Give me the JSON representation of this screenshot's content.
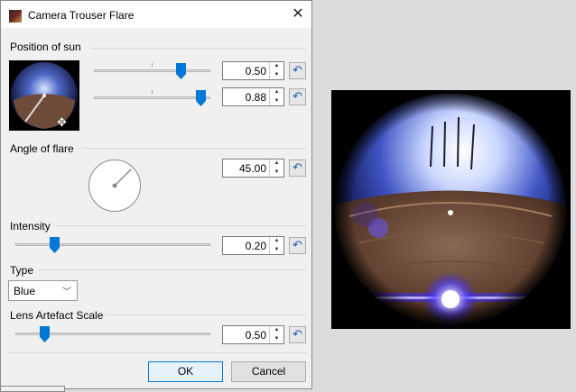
{
  "window": {
    "title": "Camera Trouser Flare"
  },
  "sections": {
    "position_of_sun": "Position of sun",
    "angle_of_flare": "Angle of flare",
    "intensity": "Intensity",
    "type": "Type",
    "lens_artefact_scale": "Lens Artefact Scale"
  },
  "controls": {
    "sun_x": {
      "value": "0.50",
      "level": 0.5
    },
    "sun_y": {
      "value": "0.88",
      "level": 0.88
    },
    "angle": {
      "value": "45.00",
      "degrees": 45
    },
    "intensity": {
      "value": "0.20",
      "level": 0.2
    },
    "type": {
      "selected": "Blue"
    },
    "lens_artefact_scale": {
      "value": "0.50",
      "level": 0.15
    }
  },
  "buttons": {
    "ok": "OK",
    "cancel": "Cancel"
  },
  "icons": {
    "close": "close-icon",
    "reset": "reset-icon",
    "spin_up": "chevron-up-icon",
    "spin_down": "chevron-down-icon",
    "dropdown": "chevron-down-icon",
    "move_cursor": "move-cursor-icon"
  },
  "colors": {
    "accent": "#0078d7",
    "dialog_bg": "#f0f0f0",
    "desktop_bg": "#dcdcdc"
  }
}
